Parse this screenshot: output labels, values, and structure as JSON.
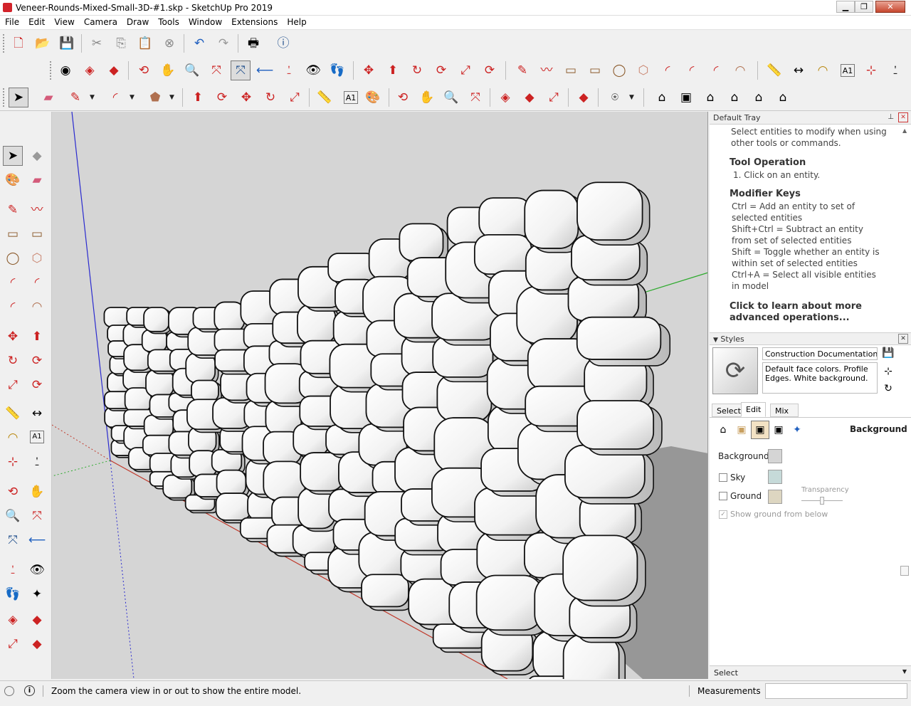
{
  "window": {
    "title": "Veneer-Rounds-Mixed-Small-3D-#1.skp - SketchUp Pro 2019",
    "minimize": "▁",
    "maximize": "❐",
    "close": "✕"
  },
  "menu": [
    "File",
    "Edit",
    "View",
    "Camera",
    "Draw",
    "Tools",
    "Window",
    "Extensions",
    "Help"
  ],
  "icons": {
    "new": "🗋",
    "open": "📂",
    "save": "💾",
    "cut": "✂",
    "copy": "⎘",
    "paste": "📋",
    "erase": "⊗",
    "undo": "↶",
    "redo": "↷",
    "print": "🖶",
    "model-info": "ⓘ",
    "select": "➤",
    "eraser": "▰",
    "pencil": "✎",
    "arc": "◜",
    "shape": "⬟",
    "push": "⬆",
    "follow": "⟳",
    "move": "✥",
    "rotate": "↻",
    "scale": "⤢",
    "tape": "📏",
    "text": "A1",
    "paint": "🎨",
    "orbit": "⟲",
    "pan": "✋",
    "zoom": "🔍",
    "zoom-extents": "⤧",
    "prev": "⟵",
    "walk": "👣",
    "eye": "👁",
    "warehouse": "◈",
    "ext": "◆",
    "account": "⍟",
    "iso": "⌂",
    "top": "▣",
    "front": "⌂",
    "right": "⌂",
    "back": "⌂",
    "left": "⌂",
    "freehand": "〰",
    "rectangle": "▭",
    "circle": "◯",
    "polygon": "⬡",
    "line": "╱",
    "protractor": "◠",
    "axes": "⊹",
    "dim": "↔",
    "section": "✦",
    "position-camera": "⍘",
    "look": "◉"
  },
  "tray": {
    "title": "Default Tray",
    "pin": "⊥",
    "close": "✕",
    "intro": "Select entities to modify when using other tools or commands.",
    "op_title": "Tool Operation",
    "op_step": "1. Click on an entity.",
    "mk_title": "Modifier Keys",
    "mk_lines": [
      "Ctrl = Add an entity to set of selected entities",
      "Shift+Ctrl = Subtract an entity from set of selected entities",
      "Shift = Toggle whether an entity is within set of selected entities",
      "Ctrl+A = Select all visible entities in model"
    ],
    "learn": "Click to learn about more advanced operations...",
    "styles_title": "Styles",
    "style_name": "Construction Documentation Sty",
    "style_desc": "Default face colors. Profile Edges. White background.",
    "tabs": [
      "Select",
      "Edit",
      "Mix"
    ],
    "active_tab": "Edit",
    "section_label": "Background",
    "bg_label": "Background",
    "sky_label": "Sky",
    "ground_label": "Ground",
    "transparency_label": "Transparency",
    "show_ground": "Show ground from below",
    "bottom_label": "Select",
    "colors": {
      "background": "#d5d5d5",
      "sky": "#c6dad9",
      "ground": "#ddd6c1"
    },
    "sky_checked": false,
    "ground_checked": false,
    "show_ground_checked": true
  },
  "status": {
    "message": "Zoom the camera view in or out to show the entire model.",
    "measurements_label": "Measurements",
    "measurements_value": ""
  },
  "colors": {
    "accent": "#d2232a",
    "viewport_bg": "#d5d5d5",
    "axis_red": "#c0392b",
    "axis_green": "#2eaa2e",
    "axis_blue": "#2a2acf"
  }
}
